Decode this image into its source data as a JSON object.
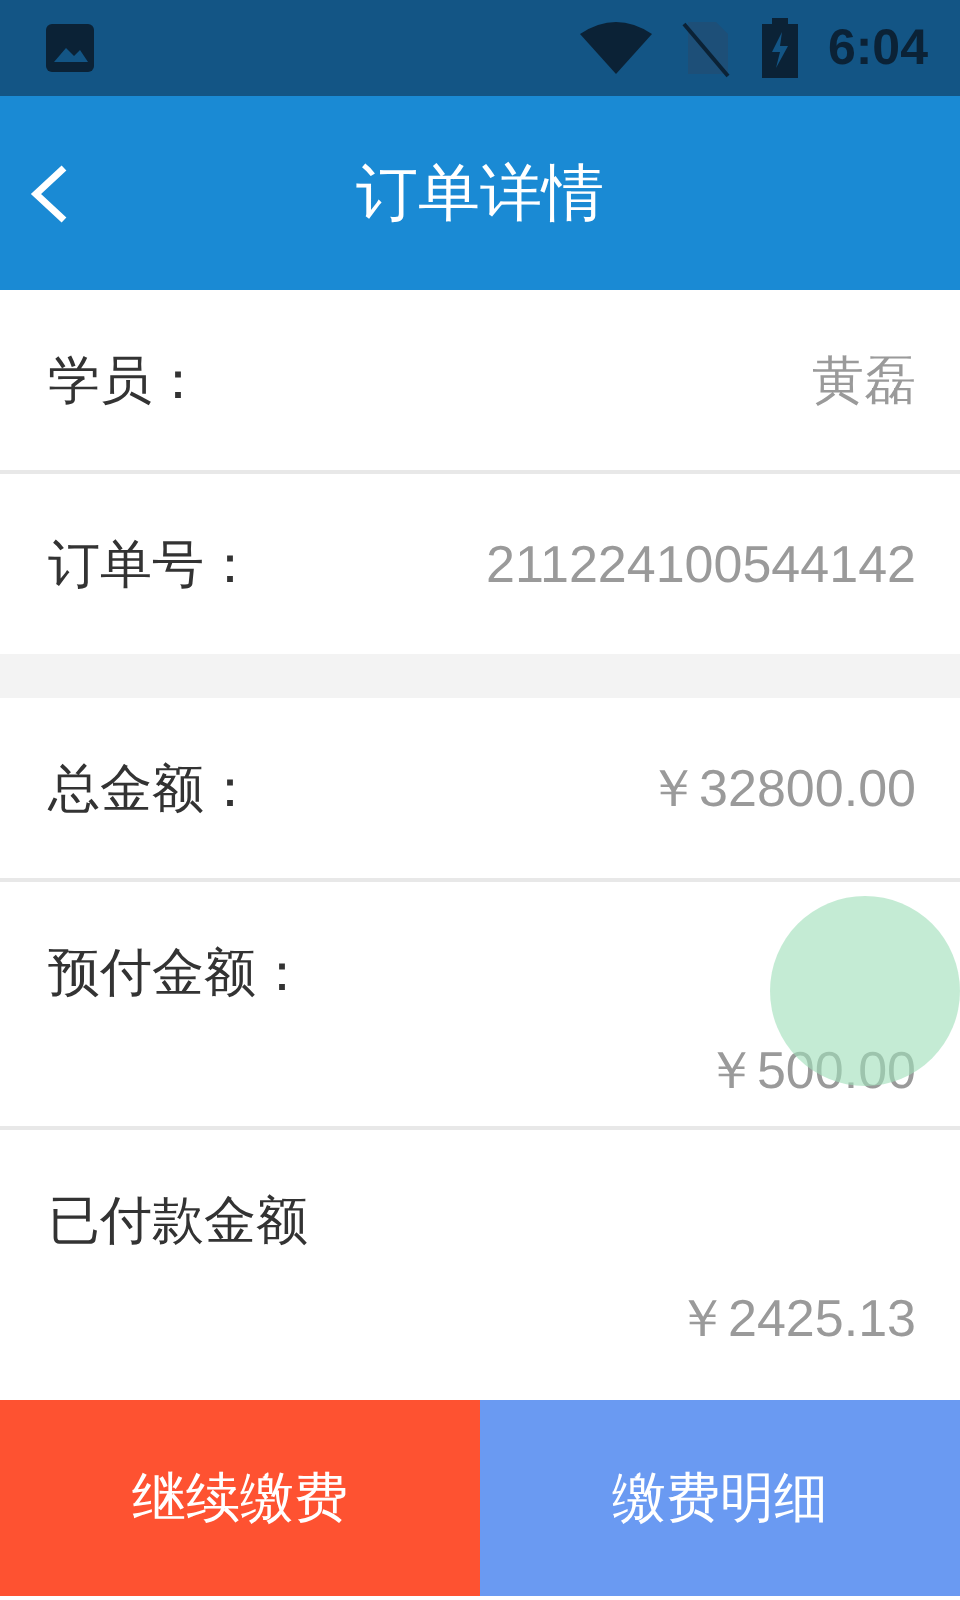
{
  "status_bar": {
    "time": "6:04"
  },
  "header": {
    "title": "订单详情"
  },
  "sections": [
    {
      "rows": [
        {
          "kind": "inline",
          "label": "学员：",
          "value": "黄磊"
        },
        {
          "kind": "inline",
          "label": "订单号：",
          "value": "211224100544142"
        }
      ]
    },
    {
      "rows": [
        {
          "kind": "inline",
          "label": "总金额：",
          "value": "￥32800.00"
        },
        {
          "kind": "stacked",
          "label": "预付金额：",
          "value": "￥500.00"
        },
        {
          "kind": "stacked",
          "label": "已付款金额",
          "value": "￥2425.13"
        }
      ]
    }
  ],
  "buttons": [
    {
      "label": "继续缴费",
      "kind": "primary"
    },
    {
      "label": "缴费明细",
      "kind": "secondary"
    }
  ]
}
